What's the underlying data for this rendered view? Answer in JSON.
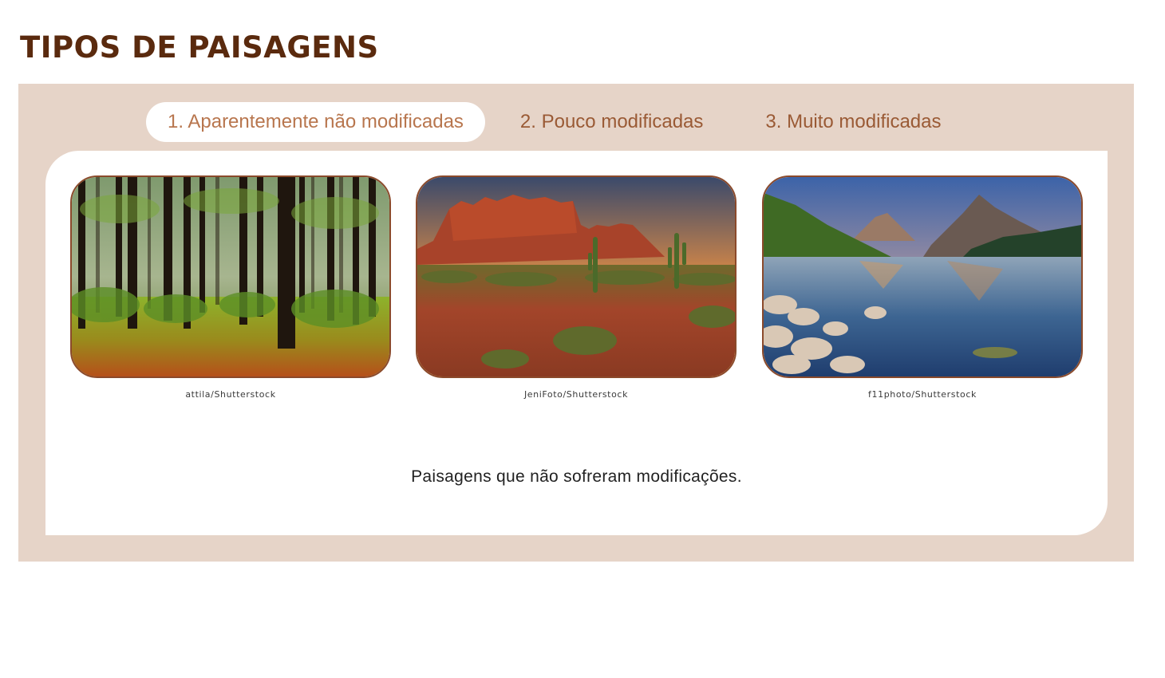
{
  "page": {
    "title": "TIPOS DE PAISAGENS"
  },
  "tabs": [
    {
      "label": "1. Aparentemente não modificadas",
      "active": true
    },
    {
      "label": "2. Pouco modificadas",
      "active": false
    },
    {
      "label": "3. Muito modificadas",
      "active": false
    }
  ],
  "figures": [
    {
      "image": "forest-photo",
      "credit": "attila/Shutterstock"
    },
    {
      "image": "desert-photo",
      "credit": "JeniFoto/Shutterstock"
    },
    {
      "image": "mountain-lake-photo",
      "credit": "f11photo/Shutterstock"
    }
  ],
  "caption": "Paisagens que não sofreram modificações.",
  "colors": {
    "title": "#5a2a0e",
    "panel_bg": "#e6d4c8",
    "tab_text": "#9a5a35",
    "photo_border": "#8b4a2b"
  }
}
